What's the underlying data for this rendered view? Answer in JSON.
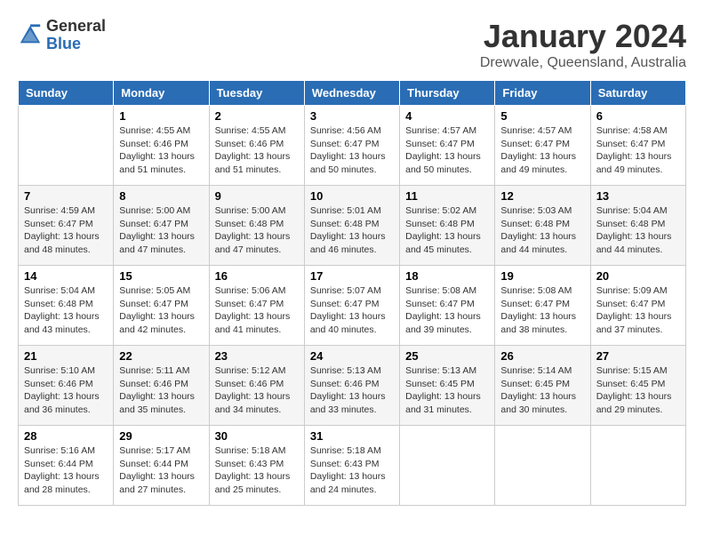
{
  "logo": {
    "general": "General",
    "blue": "Blue"
  },
  "header": {
    "month": "January 2024",
    "location": "Drewvale, Queensland, Australia"
  },
  "weekdays": [
    "Sunday",
    "Monday",
    "Tuesday",
    "Wednesday",
    "Thursday",
    "Friday",
    "Saturday"
  ],
  "weeks": [
    [
      {
        "day": "",
        "info": ""
      },
      {
        "day": "1",
        "info": "Sunrise: 4:55 AM\nSunset: 6:46 PM\nDaylight: 13 hours\nand 51 minutes."
      },
      {
        "day": "2",
        "info": "Sunrise: 4:55 AM\nSunset: 6:46 PM\nDaylight: 13 hours\nand 51 minutes."
      },
      {
        "day": "3",
        "info": "Sunrise: 4:56 AM\nSunset: 6:47 PM\nDaylight: 13 hours\nand 50 minutes."
      },
      {
        "day": "4",
        "info": "Sunrise: 4:57 AM\nSunset: 6:47 PM\nDaylight: 13 hours\nand 50 minutes."
      },
      {
        "day": "5",
        "info": "Sunrise: 4:57 AM\nSunset: 6:47 PM\nDaylight: 13 hours\nand 49 minutes."
      },
      {
        "day": "6",
        "info": "Sunrise: 4:58 AM\nSunset: 6:47 PM\nDaylight: 13 hours\nand 49 minutes."
      }
    ],
    [
      {
        "day": "7",
        "info": "Sunrise: 4:59 AM\nSunset: 6:47 PM\nDaylight: 13 hours\nand 48 minutes."
      },
      {
        "day": "8",
        "info": "Sunrise: 5:00 AM\nSunset: 6:47 PM\nDaylight: 13 hours\nand 47 minutes."
      },
      {
        "day": "9",
        "info": "Sunrise: 5:00 AM\nSunset: 6:48 PM\nDaylight: 13 hours\nand 47 minutes."
      },
      {
        "day": "10",
        "info": "Sunrise: 5:01 AM\nSunset: 6:48 PM\nDaylight: 13 hours\nand 46 minutes."
      },
      {
        "day": "11",
        "info": "Sunrise: 5:02 AM\nSunset: 6:48 PM\nDaylight: 13 hours\nand 45 minutes."
      },
      {
        "day": "12",
        "info": "Sunrise: 5:03 AM\nSunset: 6:48 PM\nDaylight: 13 hours\nand 44 minutes."
      },
      {
        "day": "13",
        "info": "Sunrise: 5:04 AM\nSunset: 6:48 PM\nDaylight: 13 hours\nand 44 minutes."
      }
    ],
    [
      {
        "day": "14",
        "info": "Sunrise: 5:04 AM\nSunset: 6:48 PM\nDaylight: 13 hours\nand 43 minutes."
      },
      {
        "day": "15",
        "info": "Sunrise: 5:05 AM\nSunset: 6:47 PM\nDaylight: 13 hours\nand 42 minutes."
      },
      {
        "day": "16",
        "info": "Sunrise: 5:06 AM\nSunset: 6:47 PM\nDaylight: 13 hours\nand 41 minutes."
      },
      {
        "day": "17",
        "info": "Sunrise: 5:07 AM\nSunset: 6:47 PM\nDaylight: 13 hours\nand 40 minutes."
      },
      {
        "day": "18",
        "info": "Sunrise: 5:08 AM\nSunset: 6:47 PM\nDaylight: 13 hours\nand 39 minutes."
      },
      {
        "day": "19",
        "info": "Sunrise: 5:08 AM\nSunset: 6:47 PM\nDaylight: 13 hours\nand 38 minutes."
      },
      {
        "day": "20",
        "info": "Sunrise: 5:09 AM\nSunset: 6:47 PM\nDaylight: 13 hours\nand 37 minutes."
      }
    ],
    [
      {
        "day": "21",
        "info": "Sunrise: 5:10 AM\nSunset: 6:46 PM\nDaylight: 13 hours\nand 36 minutes."
      },
      {
        "day": "22",
        "info": "Sunrise: 5:11 AM\nSunset: 6:46 PM\nDaylight: 13 hours\nand 35 minutes."
      },
      {
        "day": "23",
        "info": "Sunrise: 5:12 AM\nSunset: 6:46 PM\nDaylight: 13 hours\nand 34 minutes."
      },
      {
        "day": "24",
        "info": "Sunrise: 5:13 AM\nSunset: 6:46 PM\nDaylight: 13 hours\nand 33 minutes."
      },
      {
        "day": "25",
        "info": "Sunrise: 5:13 AM\nSunset: 6:45 PM\nDaylight: 13 hours\nand 31 minutes."
      },
      {
        "day": "26",
        "info": "Sunrise: 5:14 AM\nSunset: 6:45 PM\nDaylight: 13 hours\nand 30 minutes."
      },
      {
        "day": "27",
        "info": "Sunrise: 5:15 AM\nSunset: 6:45 PM\nDaylight: 13 hours\nand 29 minutes."
      }
    ],
    [
      {
        "day": "28",
        "info": "Sunrise: 5:16 AM\nSunset: 6:44 PM\nDaylight: 13 hours\nand 28 minutes."
      },
      {
        "day": "29",
        "info": "Sunrise: 5:17 AM\nSunset: 6:44 PM\nDaylight: 13 hours\nand 27 minutes."
      },
      {
        "day": "30",
        "info": "Sunrise: 5:18 AM\nSunset: 6:43 PM\nDaylight: 13 hours\nand 25 minutes."
      },
      {
        "day": "31",
        "info": "Sunrise: 5:18 AM\nSunset: 6:43 PM\nDaylight: 13 hours\nand 24 minutes."
      },
      {
        "day": "",
        "info": ""
      },
      {
        "day": "",
        "info": ""
      },
      {
        "day": "",
        "info": ""
      }
    ]
  ]
}
